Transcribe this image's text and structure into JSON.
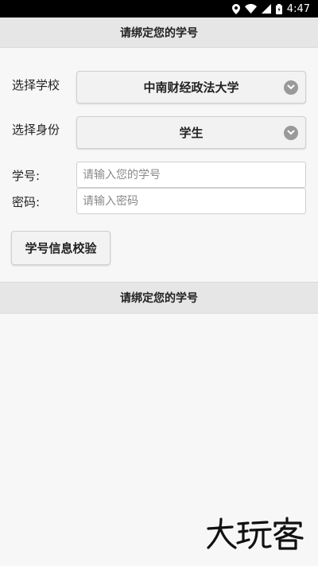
{
  "status_bar": {
    "time": "4:47",
    "icons": [
      "location-icon",
      "wifi-icon",
      "signal-icon",
      "battery-icon"
    ]
  },
  "header": {
    "title": "请绑定您的学号"
  },
  "form": {
    "school": {
      "label": "选择学校",
      "value": "中南财经政法大学"
    },
    "identity": {
      "label": "选择身份",
      "value": "学生"
    },
    "student_id": {
      "label": "学号:",
      "placeholder": "请输入您的学号"
    },
    "password": {
      "label": "密码:",
      "placeholder": "请输入密码"
    },
    "verify_button": "学号信息校验"
  },
  "section": {
    "title": "请绑定您的学号"
  },
  "watermark": {
    "text": "大玩客"
  },
  "colors": {
    "status_bar_bg": "#000000",
    "header_bg": "#e6e6e6",
    "page_bg": "#f7f7f7",
    "chevron": "#9a9a9a"
  }
}
